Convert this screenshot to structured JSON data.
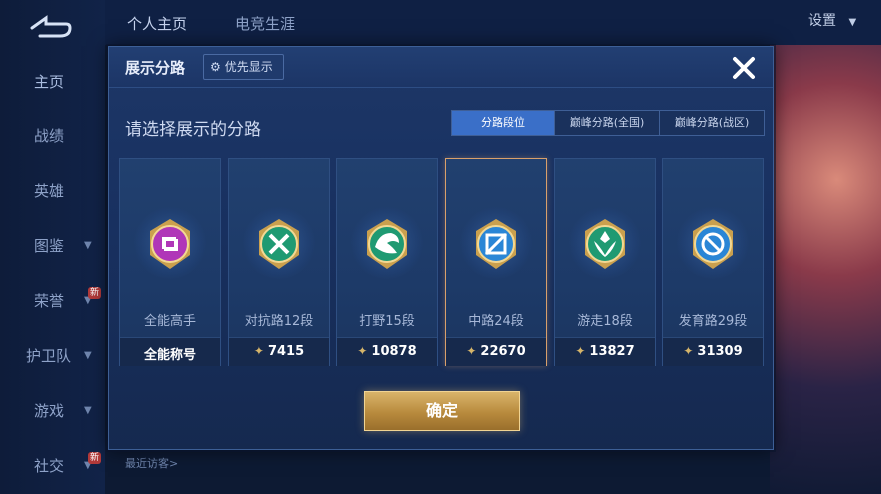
{
  "sidebar": {
    "items": [
      {
        "label": "主页",
        "chevron": false
      },
      {
        "label": "战绩",
        "chevron": false
      },
      {
        "label": "英雄",
        "chevron": false
      },
      {
        "label": "图鉴",
        "chevron": true
      },
      {
        "label": "荣誉",
        "chevron": true
      },
      {
        "label": "护卫队",
        "chevron": true
      },
      {
        "label": "游戏",
        "chevron": true
      },
      {
        "label": "社交",
        "chevron": true
      }
    ],
    "new_badge": "新"
  },
  "topbar": {
    "tabs": [
      "个人主页",
      "电竞生涯"
    ],
    "settings": "设置"
  },
  "visitor_text": "最近访客>",
  "modal": {
    "title": "展示分路",
    "priority_button": "优先显示",
    "subtitle": "请选择展示的分路",
    "segments": [
      "分路段位",
      "巅峰分路(全国)",
      "巅峰分路(战区)"
    ],
    "cards": [
      {
        "name": "全能高手",
        "score": "全能称号",
        "icon": "all-round-badge-icon",
        "color": "#b036b8"
      },
      {
        "name": "对抗路12段",
        "score": "7415",
        "icon": "clash-lane-badge-icon",
        "color": "#1f9a72"
      },
      {
        "name": "打野15段",
        "score": "10878",
        "icon": "jungle-dragon-badge-icon",
        "color": "#1f9a72"
      },
      {
        "name": "中路24段",
        "score": "22670",
        "icon": "mid-lane-badge-icon",
        "color": "#2a86d6"
      },
      {
        "name": "游走18段",
        "score": "13827",
        "icon": "roam-badge-icon",
        "color": "#1f9a72"
      },
      {
        "name": "发育路29段",
        "score": "31309",
        "icon": "farm-lane-badge-icon",
        "color": "#2a86d6"
      }
    ],
    "confirm": "确定"
  },
  "colors": {
    "accent_blue": "#3a6fc8",
    "selected_border": "#d9a06b",
    "confirm_gold": "#b88a3d"
  }
}
